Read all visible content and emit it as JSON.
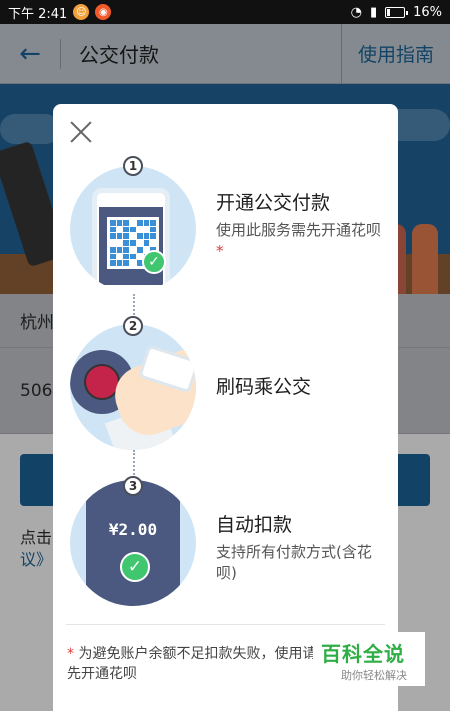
{
  "status_bar": {
    "time": "下午 2:41",
    "battery": "16%",
    "battery_level": 0.16
  },
  "app_bar": {
    "title": "公交付款",
    "guide_label": "使用指南"
  },
  "background": {
    "city_row": "杭州",
    "card_row": "506",
    "footer_line1": "点击",
    "footer_line2": "议》"
  },
  "modal": {
    "steps": [
      {
        "number": "1",
        "title": "开通公交付款",
        "desc": "使用此服务需先开通花呗",
        "required_mark": "*"
      },
      {
        "number": "2",
        "title": "刷码乘公交",
        "desc": ""
      },
      {
        "number": "3",
        "title": "自动扣款",
        "desc": "支持所有付款方式(含花呗)",
        "amount": "¥2.00"
      }
    ],
    "note_mark": "*",
    "note": "为避免账户余额不足扣款失败，使用请先开通花呗"
  },
  "watermark": {
    "title": "百科全说",
    "subtitle": "助你轻松解决"
  },
  "colors": {
    "primary": "#1a5e8e",
    "accent_green": "#3fc66f",
    "circle_bg": "#cfe5f6",
    "card": "#4b5880"
  }
}
